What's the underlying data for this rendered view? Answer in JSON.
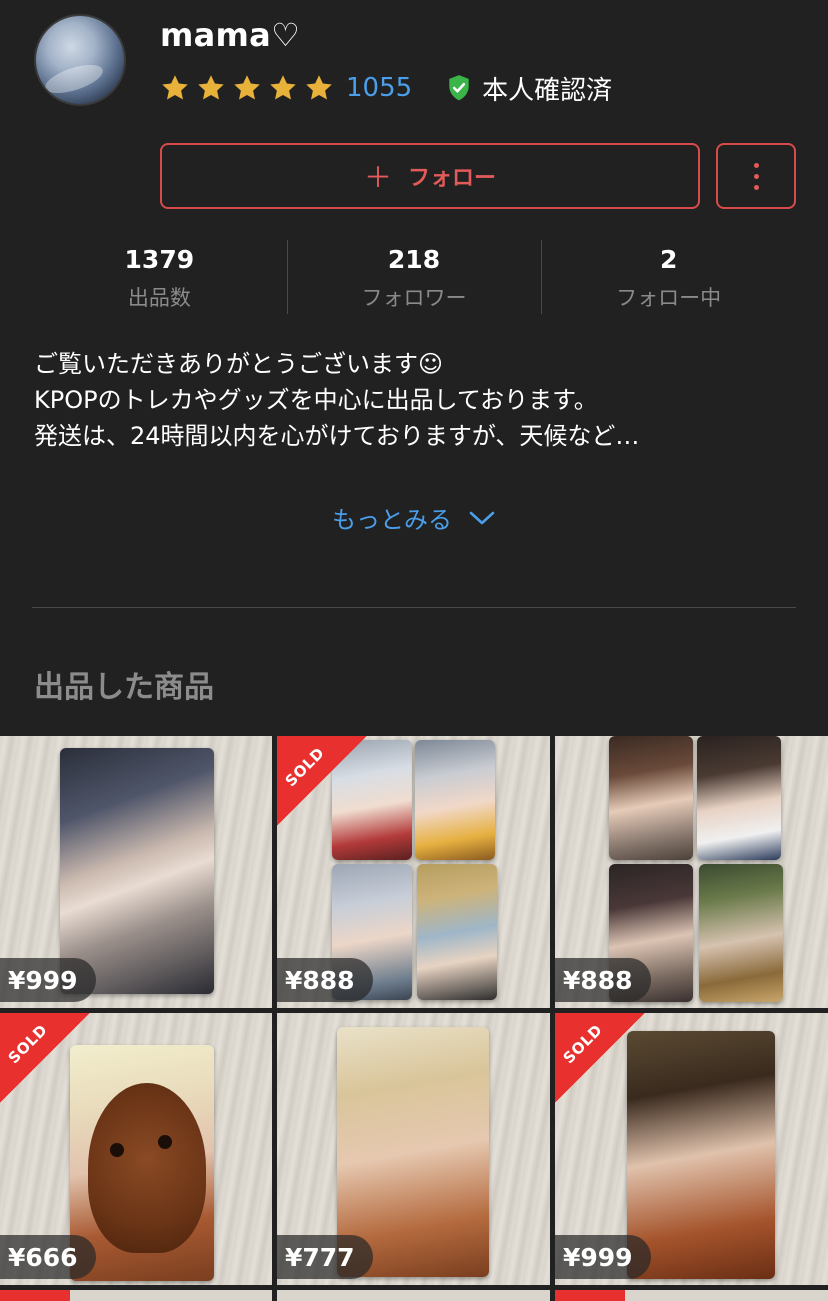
{
  "profile": {
    "username": "mama♡",
    "rating_stars": 5,
    "rating_count": "1055",
    "verified_label": "本人確認済"
  },
  "actions": {
    "follow_label": "フォロー",
    "follow_icon": "plus-icon",
    "more_icon": "kebab-menu-icon"
  },
  "stats": [
    {
      "value": "1379",
      "label": "出品数"
    },
    {
      "value": "218",
      "label": "フォロワー"
    },
    {
      "value": "2",
      "label": "フォロー中"
    }
  ],
  "bio": {
    "lines": [
      "ご覧いただきありがとうございます☺︎",
      "KPOPのトレカやグッズを中心に出品しております。",
      "発送は、24時間以内を心がけておりますが、天候など…"
    ],
    "more_label": "もっとみる"
  },
  "section_title": "出品した商品",
  "items": [
    {
      "price": "¥999",
      "sold": false
    },
    {
      "price": "¥888",
      "sold": true,
      "sold_label": "SOLD"
    },
    {
      "price": "¥888",
      "sold": false
    },
    {
      "price": "¥666",
      "sold": true,
      "sold_label": "SOLD"
    },
    {
      "price": "¥777",
      "sold": false
    },
    {
      "price": "¥999",
      "sold": true,
      "sold_label": "SOLD"
    }
  ],
  "colors": {
    "background": "#212121",
    "accent_red": "#e25a5a",
    "link_blue": "#4a9eea",
    "star_gold": "#e8b23a",
    "verified_green": "#3bb54a",
    "sold_red": "#e8302f"
  }
}
